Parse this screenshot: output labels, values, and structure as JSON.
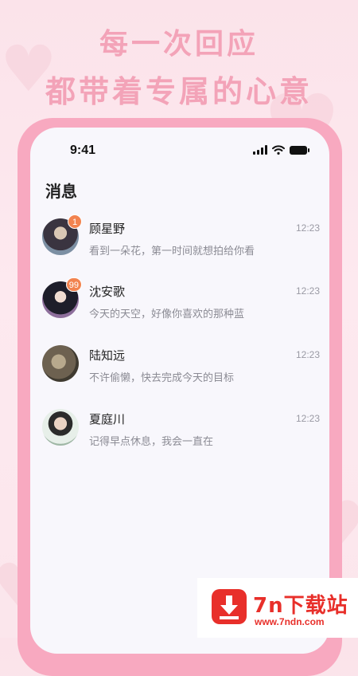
{
  "headline": {
    "line1": "每一次回应",
    "line2": "都带着专属的心意"
  },
  "status_bar": {
    "time": "9:41",
    "icons": [
      "signal-icon",
      "wifi-icon",
      "battery-icon"
    ]
  },
  "page_title": "消息",
  "messages": [
    {
      "name": "顾星野",
      "preview": "看到一朵花，第一时间就想拍给你看",
      "time": "12:23",
      "badge": "1"
    },
    {
      "name": "沈安歌",
      "preview": "今天的天空，好像你喜欢的那种蓝",
      "time": "12:23",
      "badge": "99"
    },
    {
      "name": "陆知远",
      "preview": "不许偷懒，快去完成今天的目标",
      "time": "12:23",
      "badge": ""
    },
    {
      "name": "夏庭川",
      "preview": "记得早点休息，我会一直在",
      "time": "12:23",
      "badge": ""
    }
  ],
  "watermark": {
    "title": "7n下载站",
    "url": "www.7ndn.com",
    "icon": "download-icon"
  },
  "colors": {
    "background": "#fbe3ea",
    "headline": "#f3a3b8",
    "frame": "#f8a9c0",
    "badge": "#f2834f",
    "watermark": "#e82f2a"
  }
}
